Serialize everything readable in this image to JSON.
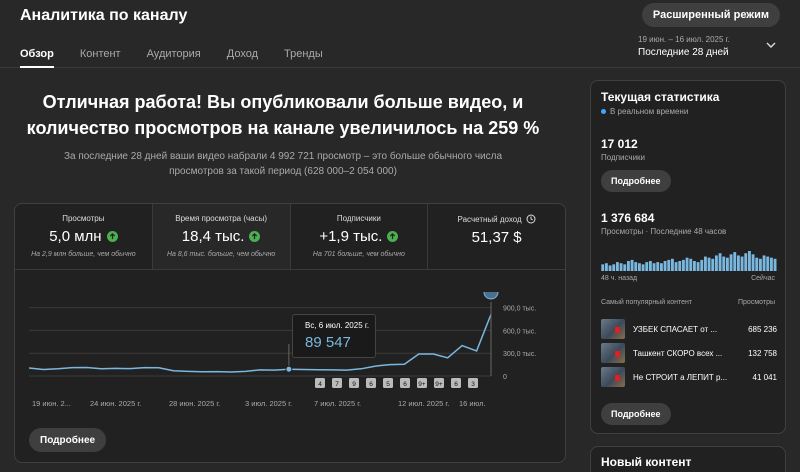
{
  "header": {
    "title": "Аналитика по каналу",
    "advanced_mode": "Расширенный режим",
    "tabs": [
      {
        "label": "Обзор",
        "active": true
      },
      {
        "label": "Контент",
        "active": false
      },
      {
        "label": "Аудитория",
        "active": false
      },
      {
        "label": "Доход",
        "active": false
      },
      {
        "label": "Тренды",
        "active": false
      }
    ],
    "period_range": "19 июн. – 16 июл. 2025 г.",
    "period_label": "Последние 28 дней"
  },
  "summary": {
    "headline_line1": "Отличная работа! Вы опубликовали больше видео, и",
    "headline_line2": "количество просмотров на канале увеличилось на 259 %",
    "subline_line1": "За последние 28 дней ваши видео набрали 4 992 721 просмотр – это больше обычного числа",
    "subline_line2": "просмотров за такой период (628 000–2 054 000)"
  },
  "metrics": [
    {
      "label": "Просмотры",
      "value": "5,0 млн",
      "note": "На 2,9 млн больше, чем обычно",
      "trend": "up"
    },
    {
      "label": "Время просмотра (часы)",
      "value": "18,4 тыс.",
      "note": "На 8,6 тыс. больше, чем обычно",
      "trend": "up"
    },
    {
      "label": "Подписчики",
      "value": "+1,9 тыс.",
      "note": "На 701 больше, чем обычно",
      "trend": "up"
    },
    {
      "label": "Расчетный доход",
      "value": "51,37 $",
      "note": "",
      "trend": "none"
    }
  ],
  "chart_data": {
    "type": "line",
    "title": "",
    "xlabel": "",
    "ylabel": "",
    "x_ticks": [
      "19 июн. 2...",
      "24 июн. 2025 г.",
      "28 июн. 2025 г.",
      "3 июл. 2025 г.",
      "7 июл. 2025 г.",
      "12 июл. 2025 г.",
      "16 июл."
    ],
    "y_ticks": [
      "900,0 тыс.",
      "600,0 тыс.",
      "300,0 тыс.",
      "0"
    ],
    "ylim": [
      0,
      1000000
    ],
    "values": [
      105000,
      85000,
      95000,
      110000,
      112000,
      95000,
      100000,
      98000,
      110000,
      108000,
      70000,
      60000,
      55000,
      58000,
      52000,
      60000,
      80000,
      78000,
      89547,
      85000,
      82000,
      80000,
      78000,
      95000,
      130000,
      150000,
      155000,
      290000,
      290000,
      240000,
      400000,
      330000,
      810000
    ],
    "uploads": [
      "4",
      "7",
      "9",
      "6",
      "5",
      "6",
      "9+",
      "9+",
      "6",
      "3"
    ],
    "tooltip_date": "Вс, 6 июл. 2025 г.",
    "tooltip_value": "89 547",
    "tooltip_index": 18,
    "line_color": "#7ab8e0"
  },
  "more_button": "Подробнее",
  "realtime": {
    "title": "Текущая статистика",
    "live_label": "В реальном времени",
    "subscribers_value": "17 012",
    "subscribers_label": "Подписчики",
    "more_button": "Подробнее",
    "views_value": "1 376 684",
    "views_label": "Просмотры · Последние 48 часов",
    "mini_left": "48 ч. назад",
    "mini_right": "Сейчас",
    "mini_bars": [
      6,
      7,
      5,
      6,
      8,
      7,
      6,
      9,
      10,
      8,
      7,
      6,
      8,
      9,
      7,
      8,
      7,
      9,
      10,
      11,
      8,
      9,
      10,
      12,
      11,
      9,
      8,
      10,
      13,
      12,
      11,
      14,
      16,
      13,
      12,
      15,
      17,
      14,
      13,
      16,
      18,
      15,
      12,
      11,
      14,
      13,
      12,
      11
    ],
    "popular_head": "Самый популярный контент",
    "popular_head_right": "Просмотры",
    "popular": [
      {
        "title": "УЗБЕК СПАСАЕТ от ...",
        "views": "685 236"
      },
      {
        "title": "Ташкент СКОРО всех ...",
        "views": "132 758"
      },
      {
        "title": "Не СТРОИТ а ЛЕПИТ р...",
        "views": "41 041"
      }
    ],
    "more_button_2": "Подробнее"
  },
  "new_content": {
    "title": "Новый контент"
  }
}
